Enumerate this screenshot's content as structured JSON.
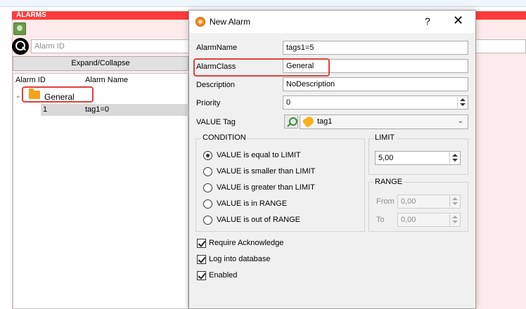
{
  "app": {
    "panel_title": "ALARMS",
    "search": {
      "placeholder": "Alarm ID",
      "value": ""
    },
    "expand_collapse_label": "Expand/Collapse",
    "tree": {
      "columns": [
        "Alarm ID",
        "Alarm Name"
      ],
      "group": "General",
      "rows": [
        {
          "id": "1",
          "name": "tag1=0"
        }
      ]
    }
  },
  "dialog": {
    "title": "New Alarm",
    "help_label": "?",
    "close_label": "✕",
    "fields": {
      "alarm_name": {
        "label": "AlarmName",
        "value": "tags1=5"
      },
      "alarm_class": {
        "label": "AlarmClass",
        "value": "General"
      },
      "description": {
        "label": "Description",
        "value": "NoDescription"
      },
      "priority": {
        "label": "Priority",
        "value": "0"
      },
      "value_tag": {
        "label": "VALUE Tag",
        "value": "tag1"
      }
    },
    "condition": {
      "title": "CONDITION",
      "options": [
        {
          "label": "VALUE is equal to LIMIT",
          "selected": true
        },
        {
          "label": "VALUE is smaller than LIMIT",
          "selected": false
        },
        {
          "label": "VALUE is greater than LIMIT",
          "selected": false
        },
        {
          "label": "VALUE is in RANGE",
          "selected": false
        },
        {
          "label": "VALUE is out of RANGE",
          "selected": false
        }
      ]
    },
    "limit": {
      "title": "LIMIT",
      "value": "5,00"
    },
    "range": {
      "title": "RANGE",
      "from_label": "From",
      "from_value": "0,00",
      "to_label": "To",
      "to_value": "0,00"
    },
    "checkboxes": [
      {
        "label": "Require Acknowledge",
        "checked": true
      },
      {
        "label": "Log into database",
        "checked": true
      },
      {
        "label": "Enabled",
        "checked": true
      }
    ],
    "colors": {
      "highlight": "#e0403a",
      "banner": "#ff3b3b",
      "folder": "#f4a21b"
    },
    "icons": [
      "alarm-app-icon",
      "search-icon",
      "folder-icon",
      "tag-icon",
      "picker-icon",
      "chevron-down-icon"
    ]
  }
}
